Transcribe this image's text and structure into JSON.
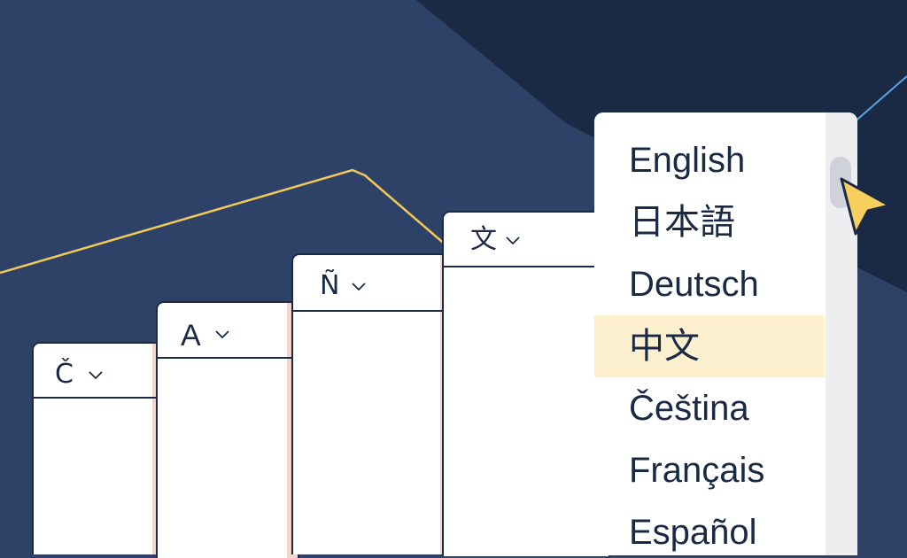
{
  "colors": {
    "background": "#2e4166",
    "background_dark": "#1a2a45",
    "card_border": "#1b2a44",
    "card_stripe": "#f2d5cd",
    "selected_row": "#fdf0cf",
    "accent_line": "#f0c95a",
    "cursor": "#f9cf5e"
  },
  "cards": [
    {
      "glyph": "Č",
      "icon": "chevron-down-icon"
    },
    {
      "glyph": "A",
      "icon": "chevron-down-icon"
    },
    {
      "glyph": "Ñ",
      "icon": "chevron-down-icon"
    },
    {
      "glyph": "文",
      "icon": "chevron-down-icon"
    }
  ],
  "dropdown": {
    "options": [
      "English",
      "日本語",
      "Deutsch",
      "中文",
      "Čeština",
      "Français",
      "Español"
    ],
    "selected": "中文"
  },
  "pointer_icon": "cursor-arrow-icon"
}
